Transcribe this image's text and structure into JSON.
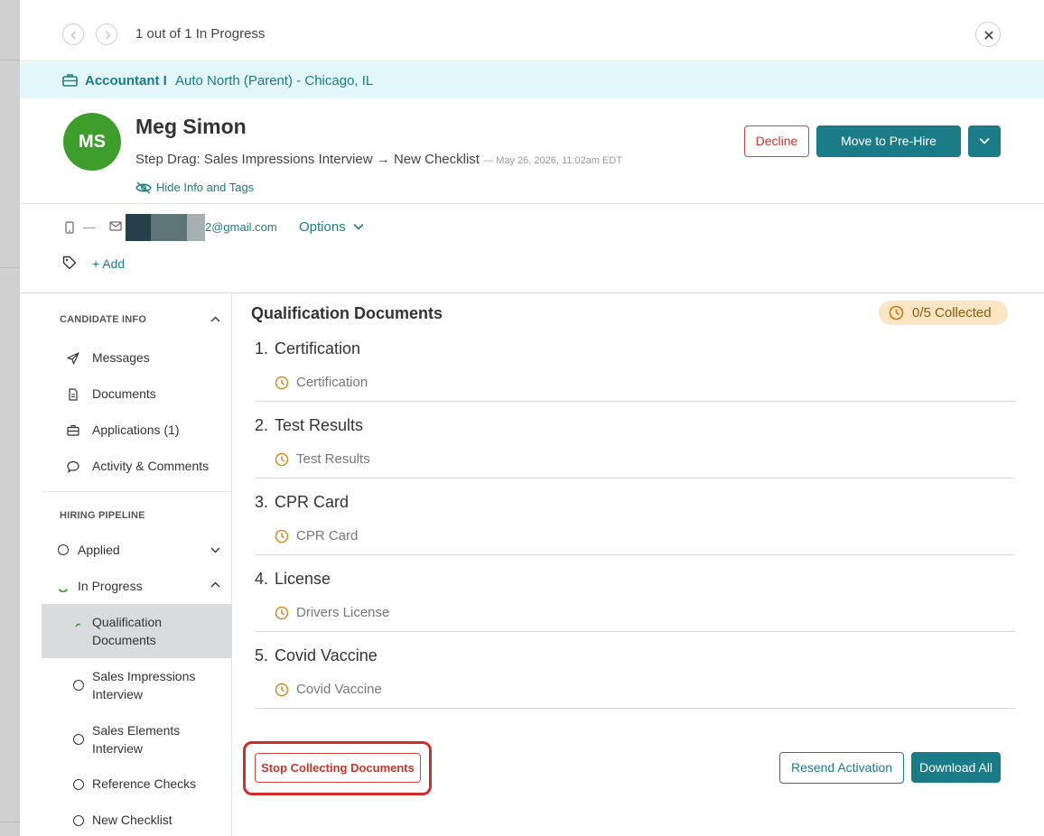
{
  "nav": {
    "status_text": "1 out of 1 In Progress"
  },
  "job": {
    "title": "Accountant I",
    "location": "Auto North (Parent) - Chicago, IL"
  },
  "candidate": {
    "initials": "MS",
    "name": "Meg Simon",
    "step": "Step Drag: Sales Impressions Interview → New Checklist",
    "step_time": "— May 26, 2026, 11:02am EDT",
    "hide_info_label": "Hide Info and Tags",
    "phone": "—",
    "email_suffix": "2@gmail.com",
    "options_label": "Options",
    "add_tag_label": "+ Add"
  },
  "actions": {
    "decline": "Decline",
    "move": "Move to Pre-Hire"
  },
  "sidebar": {
    "candidate_info_header": "CANDIDATE INFO",
    "info_items": [
      {
        "label": "Messages",
        "icon": "send-icon"
      },
      {
        "label": "Documents",
        "icon": "document-icon"
      },
      {
        "label": "Applications (1)",
        "icon": "briefcase-icon"
      },
      {
        "label": "Activity & Comments",
        "icon": "comment-icon"
      }
    ],
    "pipeline_header": "HIRING PIPELINE",
    "stages": [
      {
        "label": "Applied",
        "expanded": false
      },
      {
        "label": "In Progress",
        "expanded": true
      }
    ],
    "substeps": [
      {
        "label": "Qualification Documents",
        "active": true
      },
      {
        "label": "Sales Impressions Interview",
        "active": false
      },
      {
        "label": "Sales Elements Interview",
        "active": false
      },
      {
        "label": "Reference Checks",
        "active": false
      },
      {
        "label": "New Checklist",
        "active": false
      }
    ]
  },
  "main": {
    "title": "Qualification Documents",
    "collected": "0/5 Collected",
    "documents": [
      {
        "num": "1.",
        "name": "Certification",
        "sub": "Certification"
      },
      {
        "num": "2.",
        "name": "Test Results",
        "sub": "Test Results"
      },
      {
        "num": "3.",
        "name": "CPR Card",
        "sub": "CPR Card"
      },
      {
        "num": "4.",
        "name": "License",
        "sub": "Drivers License"
      },
      {
        "num": "5.",
        "name": "Covid Vaccine",
        "sub": "Covid Vaccine"
      }
    ],
    "stop_button": "Stop Collecting Documents",
    "resend_button": "Resend Activation",
    "download_button": "Download All"
  },
  "colors": {
    "teal": "#1a7c86",
    "red": "#c3362b",
    "avatar": "#3e9e2b",
    "banner": "#e3f6f9",
    "badge": "#fbe6c4"
  }
}
